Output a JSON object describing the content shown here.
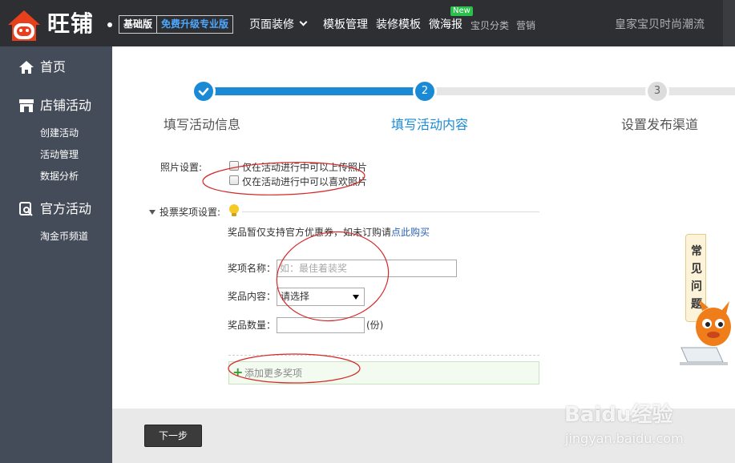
{
  "topbar": {
    "logo_text": "旺铺",
    "version_basic": "基础版",
    "version_upgrade": "免费升级专业版",
    "nav": [
      "页面装修",
      "模板管理",
      "装修模板",
      "微海报",
      "宝贝分类",
      "营销"
    ],
    "new_badge": "New",
    "shop_name": "皇家宝贝时尚潮流"
  },
  "sidebar": {
    "home": "首页",
    "shop_activity": "店铺活动",
    "shop_activity_items": [
      "创建活动",
      "活动管理",
      "数据分析"
    ],
    "official_activity": "官方活动",
    "official_activity_items": [
      "淘金币频道"
    ]
  },
  "steps": [
    {
      "number": "",
      "label": "填写活动信息",
      "state": "done"
    },
    {
      "number": "2",
      "label": "填写活动内容",
      "state": "current"
    },
    {
      "number": "3",
      "label": "设置发布渠道",
      "state": "todo"
    }
  ],
  "form": {
    "photo_label": "照片设置:",
    "photo_options": [
      {
        "label": "仅在活动进行中可以上传照片",
        "checked": false
      },
      {
        "label": "仅在活动进行中可以喜欢照片",
        "checked": false
      }
    ],
    "vote_label": "投票奖项设置:",
    "notice_prefix": "奖品暂仅支持官方优惠券，如未订购请",
    "notice_link": "点此购买",
    "prize_name_label": "奖项名称：",
    "prize_name_placeholder": "如：最佳着装奖",
    "prize_content_label": "奖品内容：",
    "prize_content_value": "请选择",
    "prize_qty_label": "奖品数量：",
    "prize_qty_unit": "(份)",
    "add_more": "添加更多奖项"
  },
  "footer": {
    "next": "下一步"
  },
  "faq": {
    "chars": [
      "常",
      "见",
      "问",
      "题"
    ]
  },
  "watermark": {
    "brand": "Baidu经验",
    "url": "jingyan.baidu.com"
  },
  "colors": {
    "accent": "#1a8ad6",
    "topbar": "#2d2f33",
    "sidebar": "#454c59",
    "annotation": "#d62828",
    "logo": "#e8401d"
  }
}
